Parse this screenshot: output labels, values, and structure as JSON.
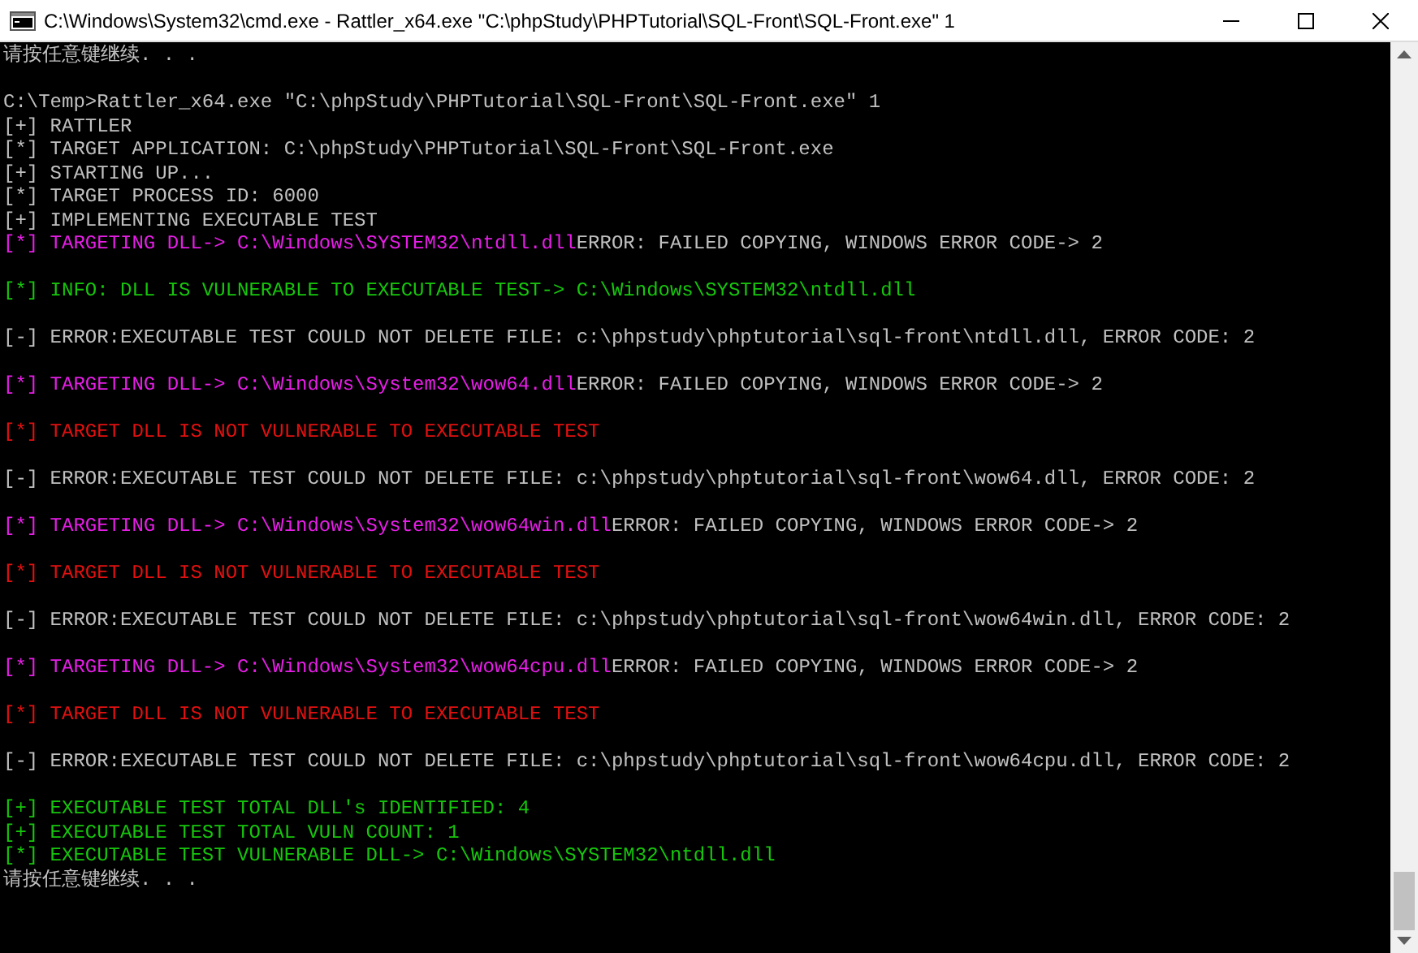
{
  "window": {
    "title": "C:\\Windows\\System32\\cmd.exe - Rattler_x64.exe  \"C:\\phpStudy\\PHPTutorial\\SQL-Front\\SQL-Front.exe\" 1"
  },
  "lines": [
    {
      "kind": "text",
      "segments": [
        {
          "text": "请按任意键继续. . .",
          "color": "#c0c0c0"
        }
      ]
    },
    {
      "kind": "blank"
    },
    {
      "kind": "text",
      "segments": [
        {
          "text": "C:\\Temp>Rattler_x64.exe \"C:\\phpStudy\\PHPTutorial\\SQL-Front\\SQL-Front.exe\" 1",
          "color": "#c0c0c0"
        }
      ]
    },
    {
      "kind": "text",
      "segments": [
        {
          "text": "[+] RATTLER",
          "color": "#c0c0c0"
        }
      ]
    },
    {
      "kind": "text",
      "segments": [
        {
          "text": "[*] TARGET APPLICATION: C:\\phpStudy\\PHPTutorial\\SQL-Front\\SQL-Front.exe",
          "color": "#c0c0c0"
        }
      ]
    },
    {
      "kind": "text",
      "segments": [
        {
          "text": "[+] STARTING UP...",
          "color": "#c0c0c0"
        }
      ]
    },
    {
      "kind": "text",
      "segments": [
        {
          "text": "[*] TARGET PROCESS ID: 6000",
          "color": "#c0c0c0"
        }
      ]
    },
    {
      "kind": "text",
      "segments": [
        {
          "text": "[+] IMPLEMENTING EXECUTABLE TEST",
          "color": "#c0c0c0"
        }
      ]
    },
    {
      "kind": "text",
      "segments": [
        {
          "text": "[*] TARGETING DLL-> C:\\Windows\\SYSTEM32\\ntdll.dll",
          "color": "#e81ee8"
        },
        {
          "text": "ERROR: FAILED COPYING, WINDOWS ERROR CODE-> 2",
          "color": "#c0c0c0"
        }
      ]
    },
    {
      "kind": "blank"
    },
    {
      "kind": "text",
      "segments": [
        {
          "text": "[*] INFO: DLL IS VULNERABLE TO EXECUTABLE TEST-> C:\\Windows\\SYSTEM32\\ntdll.dll",
          "color": "#16c60c"
        }
      ]
    },
    {
      "kind": "blank"
    },
    {
      "kind": "text",
      "segments": [
        {
          "text": "[-] ERROR:EXECUTABLE TEST COULD NOT DELETE FILE: c:\\phpstudy\\phptutorial\\sql-front\\ntdll.dll, ERROR CODE: 2",
          "color": "#c0c0c0"
        }
      ]
    },
    {
      "kind": "blank"
    },
    {
      "kind": "text",
      "segments": [
        {
          "text": "[*] TARGETING DLL-> C:\\Windows\\System32\\wow64.dll",
          "color": "#e81ee8"
        },
        {
          "text": "ERROR: FAILED COPYING, WINDOWS ERROR CODE-> 2",
          "color": "#c0c0c0"
        }
      ]
    },
    {
      "kind": "blank"
    },
    {
      "kind": "text",
      "segments": [
        {
          "text": "[*] TARGET DLL IS NOT VULNERABLE TO EXECUTABLE TEST",
          "color": "#e31010"
        }
      ]
    },
    {
      "kind": "blank"
    },
    {
      "kind": "text",
      "segments": [
        {
          "text": "[-] ERROR:EXECUTABLE TEST COULD NOT DELETE FILE: c:\\phpstudy\\phptutorial\\sql-front\\wow64.dll, ERROR CODE: 2",
          "color": "#c0c0c0"
        }
      ]
    },
    {
      "kind": "blank"
    },
    {
      "kind": "text",
      "segments": [
        {
          "text": "[*] TARGETING DLL-> C:\\Windows\\System32\\wow64win.dll",
          "color": "#e81ee8"
        },
        {
          "text": "ERROR: FAILED COPYING, WINDOWS ERROR CODE-> 2",
          "color": "#c0c0c0"
        }
      ]
    },
    {
      "kind": "blank"
    },
    {
      "kind": "text",
      "segments": [
        {
          "text": "[*] TARGET DLL IS NOT VULNERABLE TO EXECUTABLE TEST",
          "color": "#e31010"
        }
      ]
    },
    {
      "kind": "blank"
    },
    {
      "kind": "text",
      "segments": [
        {
          "text": "[-] ERROR:EXECUTABLE TEST COULD NOT DELETE FILE: c:\\phpstudy\\phptutorial\\sql-front\\wow64win.dll, ERROR CODE: 2",
          "color": "#c0c0c0"
        }
      ]
    },
    {
      "kind": "blank"
    },
    {
      "kind": "text",
      "segments": [
        {
          "text": "[*] TARGETING DLL-> C:\\Windows\\System32\\wow64cpu.dll",
          "color": "#e81ee8"
        },
        {
          "text": "ERROR: FAILED COPYING, WINDOWS ERROR CODE-> 2",
          "color": "#c0c0c0"
        }
      ]
    },
    {
      "kind": "blank"
    },
    {
      "kind": "text",
      "segments": [
        {
          "text": "[*] TARGET DLL IS NOT VULNERABLE TO EXECUTABLE TEST",
          "color": "#e31010"
        }
      ]
    },
    {
      "kind": "blank"
    },
    {
      "kind": "text",
      "segments": [
        {
          "text": "[-] ERROR:EXECUTABLE TEST COULD NOT DELETE FILE: c:\\phpstudy\\phptutorial\\sql-front\\wow64cpu.dll, ERROR CODE: 2",
          "color": "#c0c0c0"
        }
      ]
    },
    {
      "kind": "blank"
    },
    {
      "kind": "text",
      "segments": [
        {
          "text": "[+] EXECUTABLE TEST TOTAL DLL's IDENTIFIED: 4",
          "color": "#16c60c"
        }
      ]
    },
    {
      "kind": "text",
      "segments": [
        {
          "text": "[+] EXECUTABLE TEST TOTAL VULN COUNT: 1",
          "color": "#16c60c"
        }
      ]
    },
    {
      "kind": "text",
      "segments": [
        {
          "text": "[*] EXECUTABLE TEST VULNERABLE DLL-> C:\\Windows\\SYSTEM32\\ntdll.dll",
          "color": "#16c60c"
        }
      ]
    },
    {
      "kind": "text",
      "segments": [
        {
          "text": "请按任意键继续. . .",
          "color": "#c0c0c0"
        }
      ]
    }
  ]
}
